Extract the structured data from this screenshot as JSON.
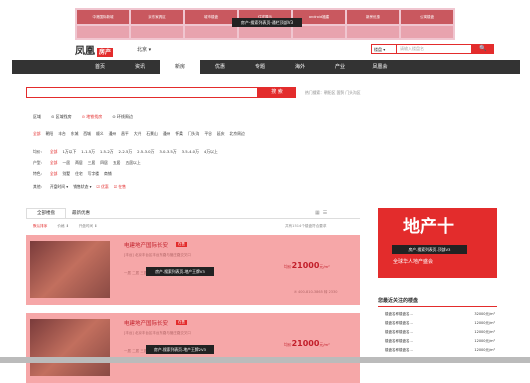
{
  "top_ad": {
    "thumbs": [
      "中港国际新城",
      "京东家具区",
      "城市楼盘",
      "住宅展示",
      "android福建",
      "新房优惠",
      "公寓楼盘"
    ],
    "row2": [
      "",
      "",
      "",
      "",
      "",
      "",
      ""
    ],
    "tooltip": "房产-搜索列表页-通栏顶部V3"
  },
  "header": {
    "logo": "凤凰",
    "logo_badge": "房产",
    "city": "北京 ▾",
    "search_select": "楼盘 ▾",
    "search_placeholder": "请输入楼盘名",
    "search_button": "🔍"
  },
  "nav": {
    "items": [
      "首页",
      "资讯",
      "新房",
      "优惠",
      "专题",
      "海外",
      "产业",
      "凤凰会"
    ],
    "active": 2
  },
  "main_search": {
    "button": "搜 索",
    "hot": "热门搜索：朝阳区  国贸  门头沟区"
  },
  "filter_tabs": [
    "区域",
    "⊙ 区域找房",
    "⊙ 地铁找房",
    "⊙ 环线周边"
  ],
  "filters": {
    "region_label": "",
    "regions": [
      "全部",
      "朝阳",
      "丰台",
      "东城",
      "西城",
      "顺义",
      "通州",
      "昌平",
      "大兴",
      "石景山",
      "通州",
      "怀柔",
      "门头沟",
      "平谷",
      "延庆",
      "北京周边"
    ],
    "price_label": "均价:",
    "prices": [
      "全部",
      "1万以下",
      "1-1.5万",
      "1.5-2万",
      "2-2.5万",
      "2.5-3.0万",
      "3.0-3.5万",
      "3.5-4.0万",
      "4万以上"
    ],
    "type_label": "户型:",
    "types": [
      "全部",
      "一居",
      "两居",
      "三居",
      "四居",
      "五居",
      "五居以上"
    ],
    "feature_label": "特色:",
    "features": [
      "全部",
      "别墅",
      "住宅",
      "写字楼",
      "商铺"
    ],
    "other_label": "其他:",
    "others": [
      "开盘时间 ▾",
      "销售状态 ▾",
      "☑ 优惠",
      "☑ 在售"
    ]
  },
  "listing_tabs": {
    "all": "全部楼盘",
    "latest": "最新优惠",
    "sort": [
      "默认排序",
      "价格 ⬇",
      "开盘时间 ⬇"
    ],
    "count": "共有1514个楼盘符合要求"
  },
  "listings": [
    {
      "name": "电建地产国际长安",
      "tag": "在售",
      "line1": "[丰台] 北京丰台区丰台东路与管庄路交叉口",
      "line2": "一居  二居  三居",
      "price_prefix": "均价",
      "price": "21000",
      "price_unit": "元/m²",
      "tooltip": "房产-搜索列表页-地产王牌V3",
      "phone": "400-810-3865 转 2330"
    },
    {
      "name": "电建地产国际长安",
      "tag": "在售",
      "line1": "[丰台] 北京丰台区丰台东路与管庄路交叉口",
      "line2": "一居  二居  三居",
      "price_prefix": "均价",
      "price": "21000",
      "price_unit": "元/m²",
      "tooltip": "房产-搜索列表页-地产王牌2V3",
      "phone": ""
    }
  ],
  "sidebar": {
    "ad_big": "地产十",
    "ad_tooltip": "房产-搜索列表页-顶部V3",
    "ad_sub": "全球华人地产盛会",
    "focus_title": "您最近关注的楼盘",
    "focus_rows": [
      {
        "name": "楼盘名称楼盘名...",
        "price": "32000元/m²"
      },
      {
        "name": "楼盘名称楼盘名...",
        "price": "12000元/m²"
      },
      {
        "name": "楼盘名称楼盘名...",
        "price": "12000元/m²"
      },
      {
        "name": "楼盘名称楼盘名...",
        "price": "12000元/m²"
      },
      {
        "name": "楼盘名称楼盘名...",
        "price": "12000元/m²"
      }
    ]
  }
}
